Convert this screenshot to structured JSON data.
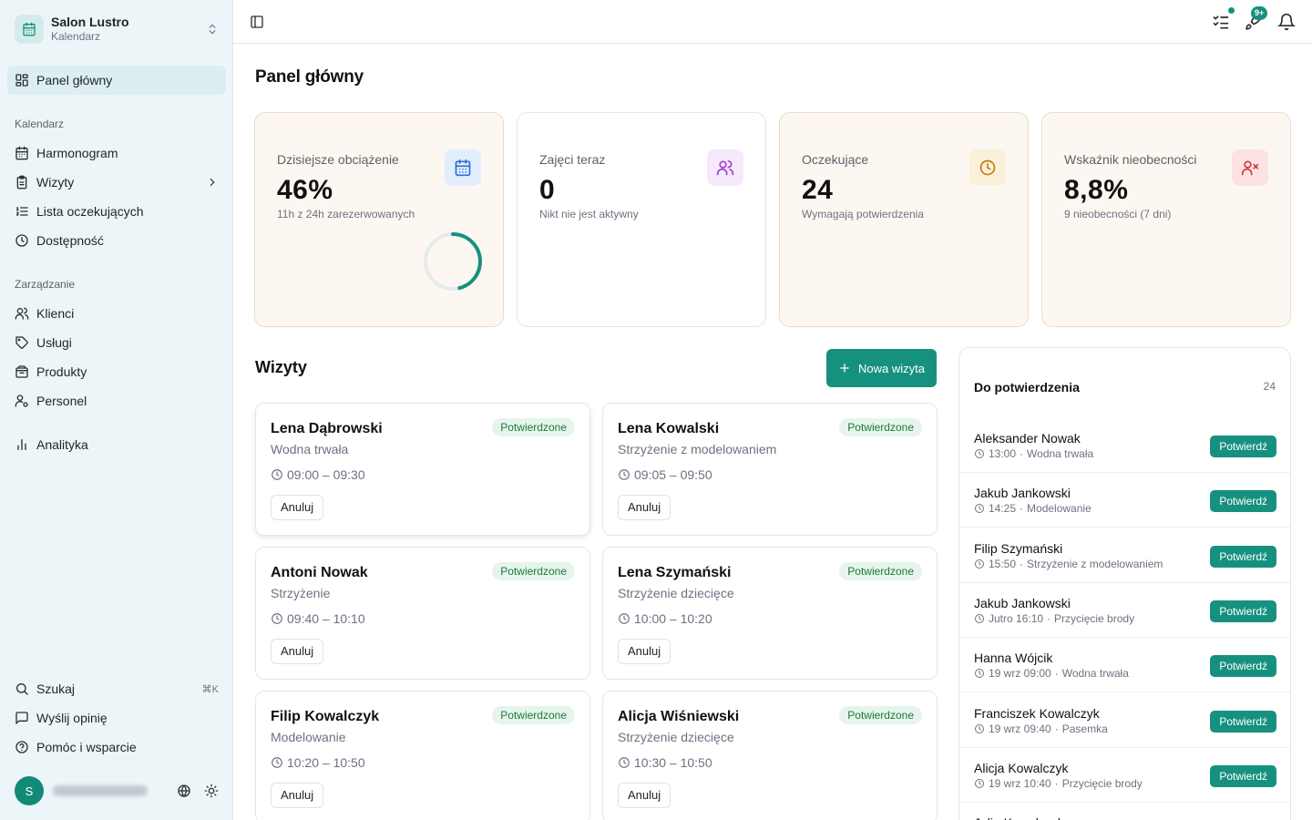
{
  "org": {
    "name": "Salon Lustro",
    "subtitle": "Kalendarz"
  },
  "nav": {
    "dashboard": "Panel główny",
    "group_calendar": "Kalendarz",
    "schedule": "Harmonogram",
    "visits": "Wizyty",
    "waitlist": "Lista oczekujących",
    "availability": "Dostępność",
    "group_management": "Zarządzanie",
    "clients": "Klienci",
    "services": "Usługi",
    "products": "Produkty",
    "staff": "Personel",
    "analytics": "Analityka",
    "search": "Szukaj",
    "search_shortcut": "⌘K",
    "feedback": "Wyślij opinię",
    "help": "Pomóc i wsparcie"
  },
  "user": {
    "initial": "S"
  },
  "topbar": {
    "badge": "9+"
  },
  "page": {
    "title": "Panel główny"
  },
  "stats": [
    {
      "label": "Dzisiejsze obciążenie",
      "value": "46%",
      "sub": "11h z 24h zarezerwowanych",
      "icon": "calendar-icon",
      "progress": 0.46
    },
    {
      "label": "Zajęci teraz",
      "value": "0",
      "sub": "Nikt nie jest aktywny",
      "icon": "users-icon"
    },
    {
      "label": "Oczekujące",
      "value": "24",
      "sub": "Wymagają potwierdzenia",
      "icon": "clock-icon"
    },
    {
      "label": "Wskaźnik nieobecności",
      "value": "8,8%",
      "sub": "9 nieobecności (7 dni)",
      "icon": "user-x-icon"
    }
  ],
  "visits": {
    "title": "Wizyty",
    "new_button": "Nowa wizyta",
    "cancel_label": "Anuluj",
    "items": [
      {
        "name": "Lena Dąbrowski",
        "service": "Wodna trwała",
        "time": "09:00 – 09:30",
        "status": "Potwierdzone"
      },
      {
        "name": "Lena Kowalski",
        "service": "Strzyżenie z modelowaniem",
        "time": "09:05 – 09:50",
        "status": "Potwierdzone"
      },
      {
        "name": "Antoni Nowak",
        "service": "Strzyżenie",
        "time": "09:40 – 10:10",
        "status": "Potwierdzone"
      },
      {
        "name": "Lena Szymański",
        "service": "Strzyżenie dziecięce",
        "time": "10:00 – 10:20",
        "status": "Potwierdzone"
      },
      {
        "name": "Filip Kowalczyk",
        "service": "Modelowanie",
        "time": "10:20 – 10:50",
        "status": "Potwierdzone"
      },
      {
        "name": "Alicja Wiśniewski",
        "service": "Strzyżenie dziecięce",
        "time": "10:30 – 10:50",
        "status": "Potwierdzone"
      }
    ]
  },
  "confirmations": {
    "title": "Do potwierdzenia",
    "count": "24",
    "button_label": "Potwierdź",
    "items": [
      {
        "name": "Aleksander Nowak",
        "when": "13:00",
        "service": "Wodna trwała"
      },
      {
        "name": "Jakub Jankowski",
        "when": "14:25",
        "service": "Modelowanie"
      },
      {
        "name": "Filip Szymański",
        "when": "15:50",
        "service": "Strzyżenie z modelowaniem"
      },
      {
        "name": "Jakub Jankowski",
        "when": "Jutro 16:10",
        "service": "Przycięcie brody"
      },
      {
        "name": "Hanna Wójcik",
        "when": "19 wrz 09:00",
        "service": "Wodna trwała"
      },
      {
        "name": "Franciszek Kowalczyk",
        "when": "19 wrz 09:40",
        "service": "Pasemka"
      },
      {
        "name": "Alicja Kowalczyk",
        "when": "19 wrz 10:40",
        "service": "Przycięcie brody"
      },
      {
        "name": "Julia Kowalczyk",
        "when": "",
        "service": ""
      }
    ]
  },
  "colors": {
    "accent": "#17917f",
    "sidebar_bg": "#ecf6f9",
    "warm_card": "#fcf8f1",
    "status_green": "#1b7a3d"
  }
}
